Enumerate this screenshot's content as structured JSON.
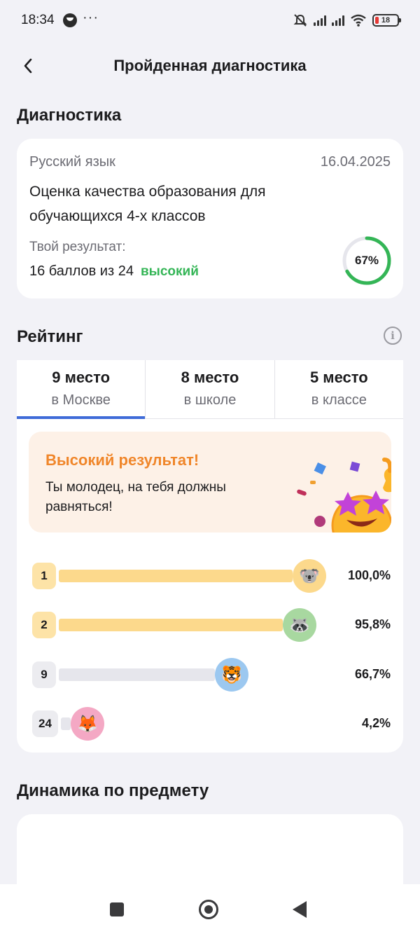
{
  "status_bar": {
    "time": "18:34",
    "more": "···",
    "battery": "18",
    "icons": [
      "chat-bubble-icon",
      "mute-icon",
      "signal-icon",
      "signal-icon",
      "wifi-icon",
      "battery-icon"
    ]
  },
  "header": {
    "title": "Пройденная диагностика",
    "back_icon": "chevron-left-icon"
  },
  "diagnostics": {
    "section_title": "Диагностика",
    "subject": "Русский язык",
    "date": "16.04.2025",
    "name": "Оценка качества образования для обучающихся 4-х классов",
    "result_label": "Твой результат:",
    "score": "16 баллов из 24",
    "level": "высокий",
    "percent_label": "67%",
    "percent": 0.67,
    "ring_color": "#34b556",
    "level_color": "#34b556"
  },
  "rating": {
    "section_title": "Рейтинг",
    "info_icon": "info-icon",
    "info_symbol": "i",
    "tabs": [
      {
        "place": "9 место",
        "where": "в Москве",
        "active": true
      },
      {
        "place": "8 место",
        "where": "в школе",
        "active": false
      },
      {
        "place": "5 место",
        "where": "в классе",
        "active": false
      }
    ],
    "banner": {
      "title": "Высокий результат!",
      "text": "Ты молодец, на тебя должны равняться!",
      "title_color": "#f0862a"
    },
    "leaders": [
      {
        "rank": "1",
        "percent": "100,0%",
        "value": 1.0,
        "avatar": "koala-avatar",
        "emoji": "🐨"
      },
      {
        "rank": "2",
        "percent": "95,8%",
        "value": 0.958,
        "avatar": "raccoon-avatar",
        "emoji": "🦝"
      },
      {
        "rank": "9",
        "percent": "66,7%",
        "value": 0.667,
        "avatar": "tiger-avatar",
        "emoji": "🐯"
      },
      {
        "rank": "24",
        "percent": "4,2%",
        "value": 0.042,
        "avatar": "fox-avatar",
        "emoji": "🦊"
      }
    ]
  },
  "dynamics": {
    "section_title": "Динамика по предмету"
  },
  "nav": {
    "icons": [
      "recent-apps-icon",
      "home-icon",
      "back-icon"
    ]
  }
}
